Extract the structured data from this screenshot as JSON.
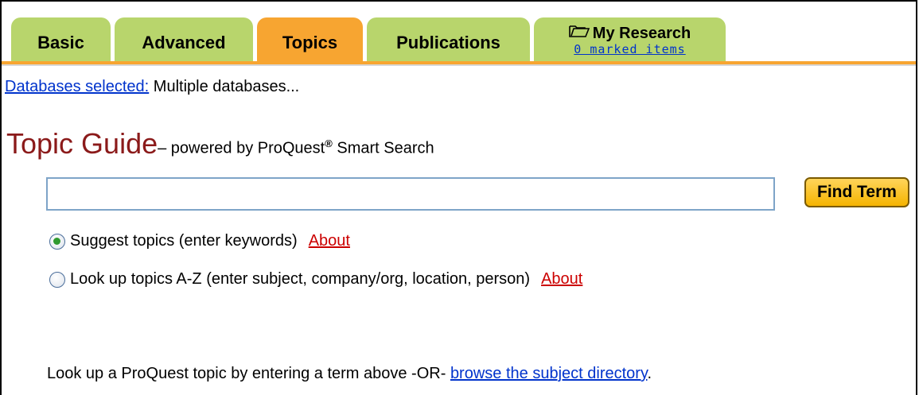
{
  "tabs": {
    "basic": "Basic",
    "advanced": "Advanced",
    "topics": "Topics",
    "publications": "Publications",
    "my_research": "My Research",
    "marked_items": "0 marked items"
  },
  "databases": {
    "link": "Databases selected:",
    "value": "Multiple databases..."
  },
  "header": {
    "title": "Topic Guide",
    "subtitle_prefix": "– powered by ProQuest",
    "registered": "®",
    "subtitle_suffix": " Smart Search"
  },
  "search": {
    "value": "",
    "button": "Find Term"
  },
  "options": [
    {
      "label": "Suggest topics (enter keywords)",
      "about": "About",
      "checked": true
    },
    {
      "label": "Look up topics A-Z (enter subject, company/org, location, person)",
      "about": "About",
      "checked": false
    }
  ],
  "footer": {
    "prefix": "Look up a ProQuest topic by entering a term above -OR- ",
    "link": "browse the subject directory",
    "suffix": "."
  },
  "colors": {
    "tab_green": "#b8d56c",
    "tab_active": "#f7a531",
    "title_red": "#8b1a1a",
    "link_blue": "#0033cc",
    "about_red": "#cc0000"
  }
}
